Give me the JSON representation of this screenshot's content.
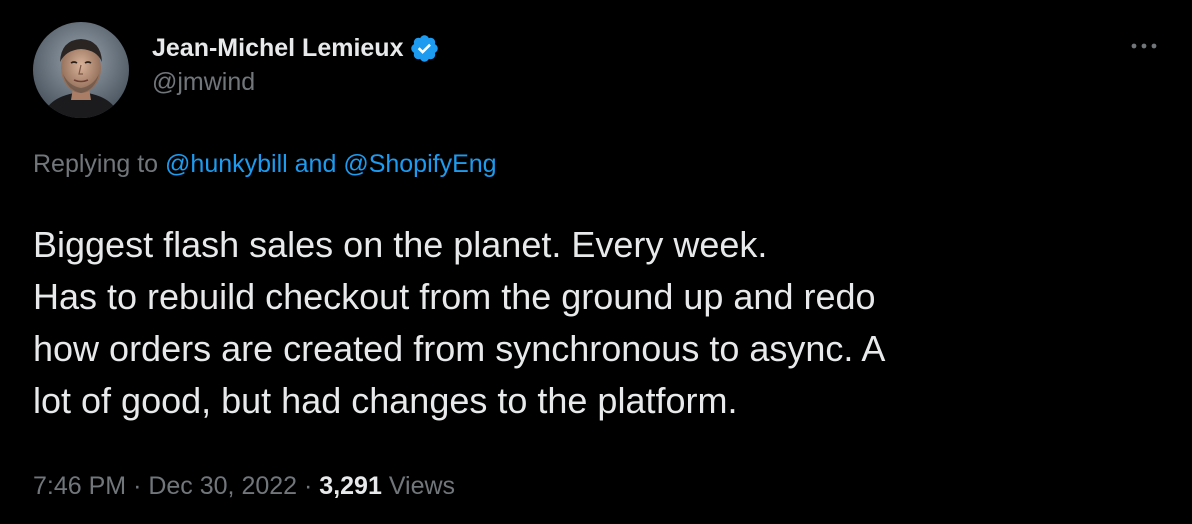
{
  "author": {
    "display_name": "Jean-Michel Lemieux",
    "handle": "@jmwind",
    "verified_icon": "verified-badge-icon"
  },
  "reply": {
    "prefix": "Replying to",
    "mention_1": "@hunkybill",
    "conjunction": "and",
    "mention_2": "@ShopifyEng"
  },
  "tweet": {
    "lines": [
      "Biggest flash sales on the planet. Every week.",
      "Has to rebuild checkout from the ground up and redo",
      "how orders are created from synchronous to async. A",
      "lot of good, but had changes to the platform."
    ]
  },
  "meta": {
    "time": "7:46 PM",
    "separator": "·",
    "date": "Dec 30, 2022",
    "views_count": "3,291",
    "views_label": "Views"
  },
  "colors": {
    "background": "#000000",
    "text_primary": "#e7e9ea",
    "text_secondary": "#71767b",
    "accent": "#1d9bf0"
  }
}
